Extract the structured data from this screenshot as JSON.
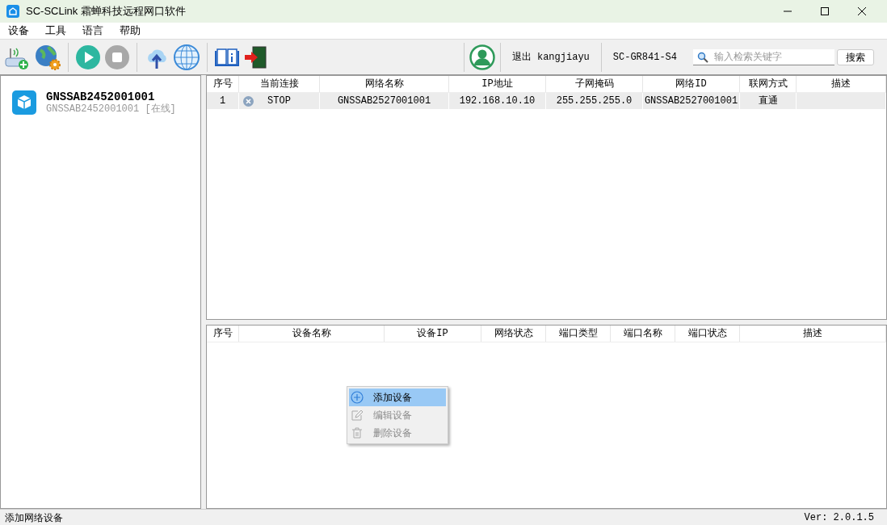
{
  "window": {
    "title": "SC-SCLink 霜蝉科技远程网口软件"
  },
  "menu": [
    "设备",
    "工具",
    "语言",
    "帮助"
  ],
  "toolbar": {
    "logout": "退出 kangjiayu",
    "device": "SC-GR841-S4",
    "search": {
      "placeholder": "输入检索关键字"
    },
    "search_button": "搜索"
  },
  "sidebar": {
    "items": [
      {
        "name": "GNSSAB2452001001",
        "subtitle": "GNSSAB2452001001 [在线]"
      }
    ]
  },
  "networks": {
    "columns": [
      "序号",
      "当前连接",
      "网络名称",
      "IP地址",
      "子网掩码",
      "网络ID",
      "联网方式",
      "描述"
    ],
    "rows": [
      {
        "selected": true,
        "cells": [
          "1",
          "STOP",
          "GNSSAB2527001001",
          "192.168.10.10",
          "255.255.255.0",
          "GNSSAB2527001001",
          "直通",
          ""
        ]
      }
    ]
  },
  "devices": {
    "columns": [
      "序号",
      "设备名称",
      "设备IP",
      "网络状态",
      "端口类型",
      "端口名称",
      "端口状态",
      "描述"
    ]
  },
  "context_menu": {
    "items": [
      {
        "kind": "add",
        "label": "添加设备",
        "selected": true,
        "disabled": false
      },
      {
        "kind": "edit",
        "label": "编辑设备",
        "selected": false,
        "disabled": true
      },
      {
        "kind": "delete",
        "label": "删除设备",
        "selected": false,
        "disabled": true
      }
    ]
  },
  "status_bar": {
    "message": "添加网络设备",
    "version": "Ver: 2.0.1.5"
  }
}
